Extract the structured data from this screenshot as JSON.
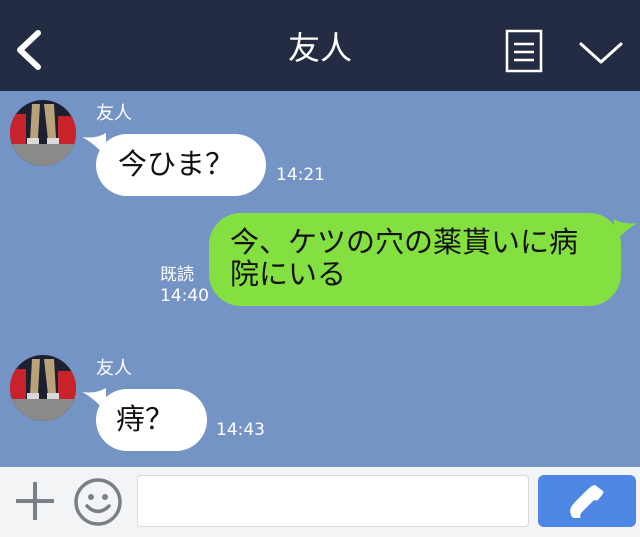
{
  "header": {
    "title": "友人"
  },
  "messages": [
    {
      "direction": "in",
      "sender": "友人",
      "text": "今ひま？",
      "time": "14:21"
    },
    {
      "direction": "out",
      "read": "既読",
      "text_line1": "今、ケツの穴の薬貰いに病",
      "text_line2": "院にいる",
      "time": "14:40"
    },
    {
      "direction": "in",
      "sender": "友人",
      "text": "痔？",
      "time": "14:43"
    }
  ],
  "composer": {
    "value": "",
    "placeholder": ""
  },
  "icons": {
    "back": "chevron-left-icon",
    "menu": "document-menu-icon",
    "collapse": "chevron-down-icon",
    "add": "plus-icon",
    "emoji": "smiley-icon",
    "call": "phone-icon"
  },
  "colors": {
    "header": "#232c42",
    "chat_background": "#7494c6",
    "incoming_bubble": "#ffffff",
    "outgoing_bubble": "#84e040",
    "call_button": "#4d86e3"
  }
}
